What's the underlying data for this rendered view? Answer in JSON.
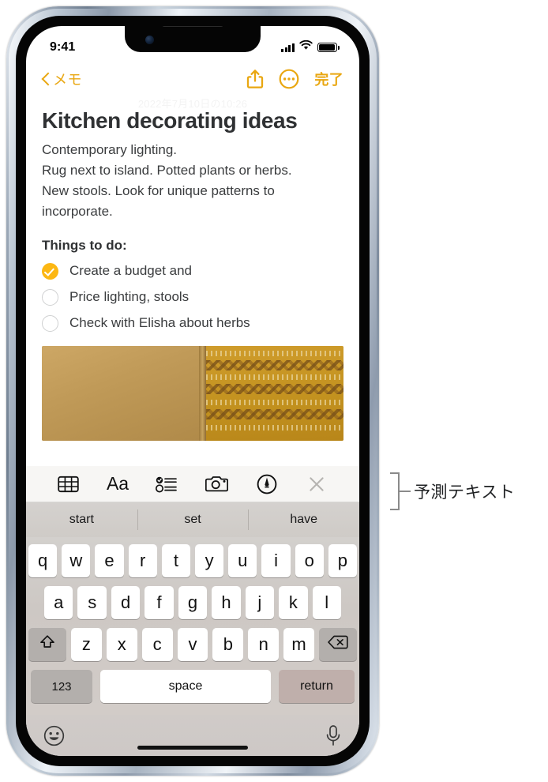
{
  "status_bar": {
    "time": "9:41",
    "signal_icon": "cellular-signal-icon",
    "wifi_icon": "wifi-icon",
    "battery_icon": "battery-full-icon"
  },
  "nav_bar": {
    "back_label": "メモ",
    "back_icon": "chevron-left-icon",
    "share_icon": "share-icon",
    "more_icon": "more-circle-icon",
    "done_label": "完了"
  },
  "note": {
    "timestamp": "2022年7月10日の10:26",
    "title": "Kitchen decorating ideas",
    "paragraphs": [
      "Contemporary lighting.",
      "Rug next to island.  Potted plants or herbs.",
      "New stools. Look for unique patterns to",
      "incorporate."
    ],
    "subheading": "Things to do:",
    "checklist": [
      {
        "label": "Create a budget and",
        "checked": true
      },
      {
        "label": "Price lighting, stools",
        "checked": false
      },
      {
        "label": "Check with Elisha about herbs",
        "checked": false
      }
    ],
    "photo_alt": "woven-textile-photo"
  },
  "keyboard_toolbar": {
    "items": [
      {
        "name": "table-icon",
        "label": ""
      },
      {
        "name": "text-format-icon",
        "label": "Aa"
      },
      {
        "name": "checklist-icon",
        "label": ""
      },
      {
        "name": "camera-icon",
        "label": ""
      },
      {
        "name": "markup-pen-icon",
        "label": ""
      },
      {
        "name": "close-icon",
        "label": ""
      }
    ]
  },
  "predictive_text": {
    "suggestions": [
      "start",
      "set",
      "have"
    ]
  },
  "keyboard": {
    "row1": [
      "q",
      "w",
      "e",
      "r",
      "t",
      "y",
      "u",
      "i",
      "o",
      "p"
    ],
    "row2": [
      "a",
      "s",
      "d",
      "f",
      "g",
      "h",
      "j",
      "k",
      "l"
    ],
    "row3": [
      "z",
      "x",
      "c",
      "v",
      "b",
      "n",
      "m"
    ],
    "shift_icon": "shift-arrow-icon",
    "backspace_icon": "backspace-icon",
    "numbers_label": "123",
    "space_label": "space",
    "return_label": "return",
    "emoji_icon": "emoji-smiley-icon",
    "dictation_icon": "microphone-icon"
  },
  "callout": {
    "label": "予測テキスト"
  },
  "colors": {
    "accent": "#E9A711",
    "checkbox_checked": "#FCB713",
    "text_primary": "#3a3c3e",
    "keyboard_bg": "#d0cbc8"
  }
}
